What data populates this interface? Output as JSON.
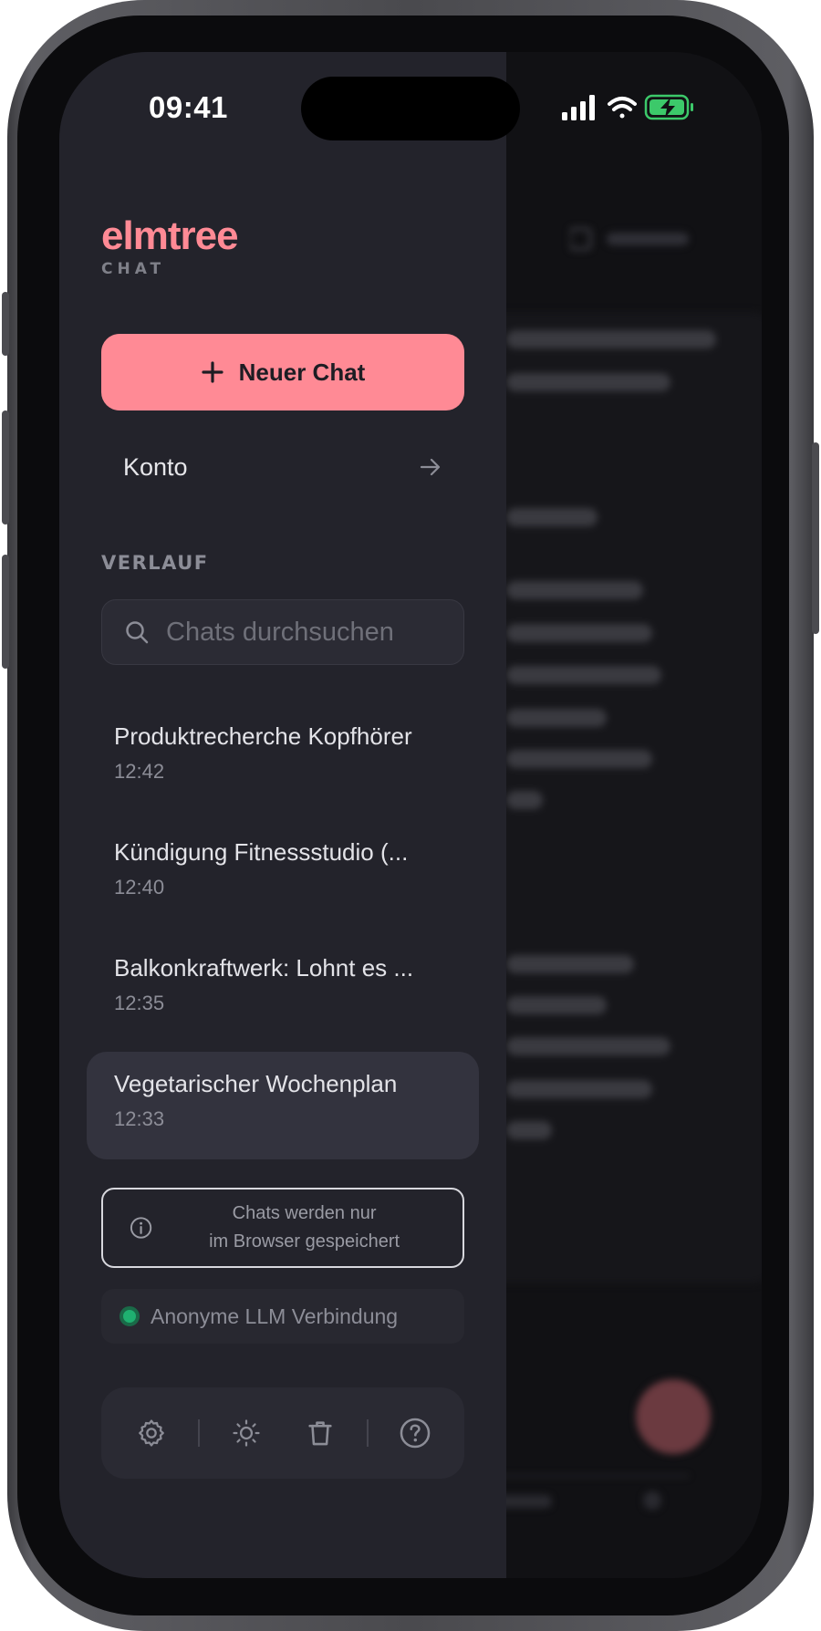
{
  "status_bar": {
    "time": "09:41"
  },
  "brand": {
    "name": "elmtree",
    "subtitle": "CHAT"
  },
  "actions": {
    "new_chat_label": "Neuer Chat",
    "account_label": "Konto"
  },
  "history": {
    "section_label": "VERLAUF",
    "search_placeholder": "Chats durchsuchen",
    "items": [
      {
        "title": "Produktrecherche Kopfhörer",
        "time": "12:42",
        "active": false
      },
      {
        "title": "Kündigung Fitnessstudio (...",
        "time": "12:40",
        "active": false
      },
      {
        "title": "Balkonkraftwerk: Lohnt es ...",
        "time": "12:35",
        "active": false
      },
      {
        "title": "Vegetarischer Wochenplan",
        "time": "12:33",
        "active": true
      }
    ]
  },
  "notice": {
    "line1": "Chats werden nur",
    "line2": "im Browser gespeichert"
  },
  "connection": {
    "label": "Anonyme LLM Verbindung",
    "status_color": "#1fb070"
  },
  "toolbar": {
    "icons": [
      "gear-icon",
      "sun-icon",
      "trash-icon",
      "help-icon"
    ]
  },
  "theme": {
    "accent": "#ff8a95",
    "drawer_bg": "#23232b"
  }
}
